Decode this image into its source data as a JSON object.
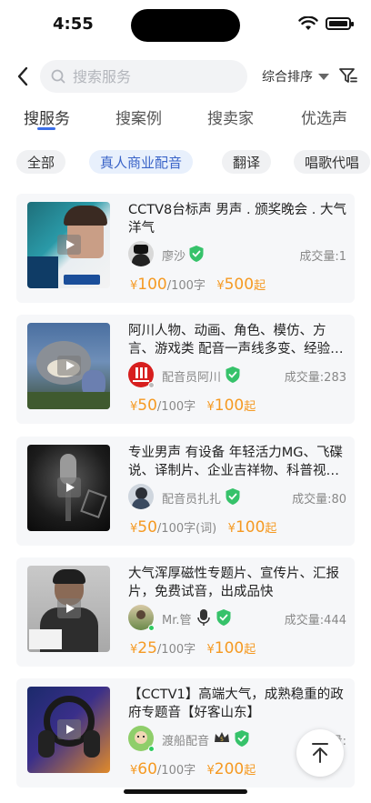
{
  "status": {
    "time": "4:55"
  },
  "search": {
    "placeholder": "搜索服务",
    "sort_label": "综合排序"
  },
  "tabs": [
    {
      "label": "搜服务"
    },
    {
      "label": "搜案例"
    },
    {
      "label": "搜卖家"
    },
    {
      "label": "优选声"
    }
  ],
  "chips": [
    {
      "label": "全部"
    },
    {
      "label": "真人商业配音"
    },
    {
      "label": "翻译"
    },
    {
      "label": "唱歌代唱"
    }
  ],
  "listings": [
    {
      "title": "CCTV8台标声 男声 . 颁奖晚会 . 大气洋气",
      "seller": "廖沙",
      "deals": "成交量:1",
      "price1": "100",
      "unit1": "/100字",
      "price2": "500",
      "suffix2": "起"
    },
    {
      "title": "阿川人物、动画、角色、模仿、方言、游戏类 配音一声线多变、经验…",
      "seller": "配音员阿川",
      "deals": "成交量:283",
      "price1": "50",
      "unit1": "/100字",
      "price2": "100",
      "suffix2": "起"
    },
    {
      "title": "专业男声 有设备 年轻活力MG、飞碟说、译制片、企业吉祥物、科普视…",
      "seller": "配音员扎扎",
      "deals": "成交量:80",
      "price1": "50",
      "unit1": "/100字(词)",
      "price2": "100",
      "suffix2": "起"
    },
    {
      "title": "大气浑厚磁性专题片、宣传片、汇报片，免费试音，出成品快",
      "seller": "Mr.管",
      "deals": "成交量:444",
      "price1": "25",
      "unit1": "/100字",
      "price2": "100",
      "suffix2": "起"
    },
    {
      "title": "【CCTV1】高端大气，成熟稳重的政府专题音【好客山东】",
      "seller": "渡船配音",
      "deals": "成交量:",
      "price1": "60",
      "unit1": "/100字",
      "price2": "200",
      "suffix2": "起"
    }
  ],
  "colors": {
    "accent": "#3b6ee8",
    "price": "#f59a23",
    "chip_active_bg": "#e8f0fc",
    "card_bg": "#f6f7f9",
    "badge_green": "#36c26a"
  },
  "icons": {
    "back": "chevron-left-icon",
    "search": "search-icon",
    "filter": "filter-icon",
    "top": "back-to-top-icon"
  }
}
